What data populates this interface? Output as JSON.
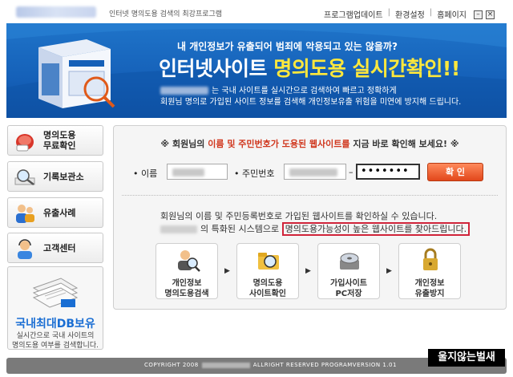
{
  "app": {
    "title": "인터넷 명의도용 검색의 최강프로그램"
  },
  "top_menu": {
    "update": "프로그램업데이트",
    "settings": "환경설정",
    "home": "홈페이지"
  },
  "banner": {
    "question": "내 개인정보가 유출되어 범죄에 악용되고 있는 않을까?",
    "main_white": "인터넷사이트 ",
    "main_yellow": "명의도용 실시간확인!!",
    "sub1": "는 국내 사이트를 실시간으로 검색하여 빠르고 정확하게",
    "sub2": "회원님 명의로 가입된 사이트 정보를 검색해 개인정보유출 위험을 미연에 방지해 드립니다."
  },
  "sidebar": {
    "items": [
      {
        "line1": "명의도용",
        "line2": "무료확인",
        "icon": "mouse-icon"
      },
      {
        "line1": "기록보관소",
        "line2": "",
        "icon": "magnifier-icon"
      },
      {
        "line1": "유출사례",
        "line2": "",
        "icon": "users-icon"
      },
      {
        "line1": "고객센터",
        "line2": "",
        "icon": "headset-user-icon"
      }
    ],
    "db_title": "국내최대DB보유",
    "db_desc1": "실시간으로 국내 사이트의",
    "db_desc2": "명의도용 여부를 검색합니다."
  },
  "notice": {
    "prefix": "※ 회원님의 ",
    "red": "이름 및 주민번호가 도용된 웹사이트를",
    "suffix": " 지금 바로 확인해 보세요! ※"
  },
  "form": {
    "name_label": "• 이름",
    "ssn_label": "• 주민번호",
    "ssn_dash": "–",
    "password_value": "•••••••",
    "confirm_label": "확 인"
  },
  "info": {
    "line1": "회원님의 이름 및 주민등록번호로 가입된 웹사이트를 확인하실 수 있습니다.",
    "line2_prefix": "의 특화된 시스템으로 ",
    "line2_highlight": "명의도용가능성이 높은 웹사이트를 찾아드립니다."
  },
  "steps": [
    {
      "line1": "개인정보",
      "line2": "명의도용검색",
      "icon": "search-person-icon"
    },
    {
      "line1": "명의도용",
      "line2": "사이트확인",
      "icon": "folder-icon"
    },
    {
      "line1": "가입사이트",
      "line2": "PC저장",
      "icon": "disk-icon"
    },
    {
      "line1": "개인정보",
      "line2": "유출방지",
      "icon": "lock-icon"
    }
  ],
  "footer": {
    "copyright_prefix": "COPYRIGHT 2008",
    "copyright_suffix": "ALLRIGHT RESERVED  PROGRAMVERSION 1.01"
  },
  "watermark": "울지않는벌새",
  "colors": {
    "banner_blue": "#1560b8",
    "accent_red": "#d0361d",
    "highlight_yellow": "#ffe83c",
    "confirm_orange": "#e2471b",
    "db_blue": "#1a6ed3"
  }
}
